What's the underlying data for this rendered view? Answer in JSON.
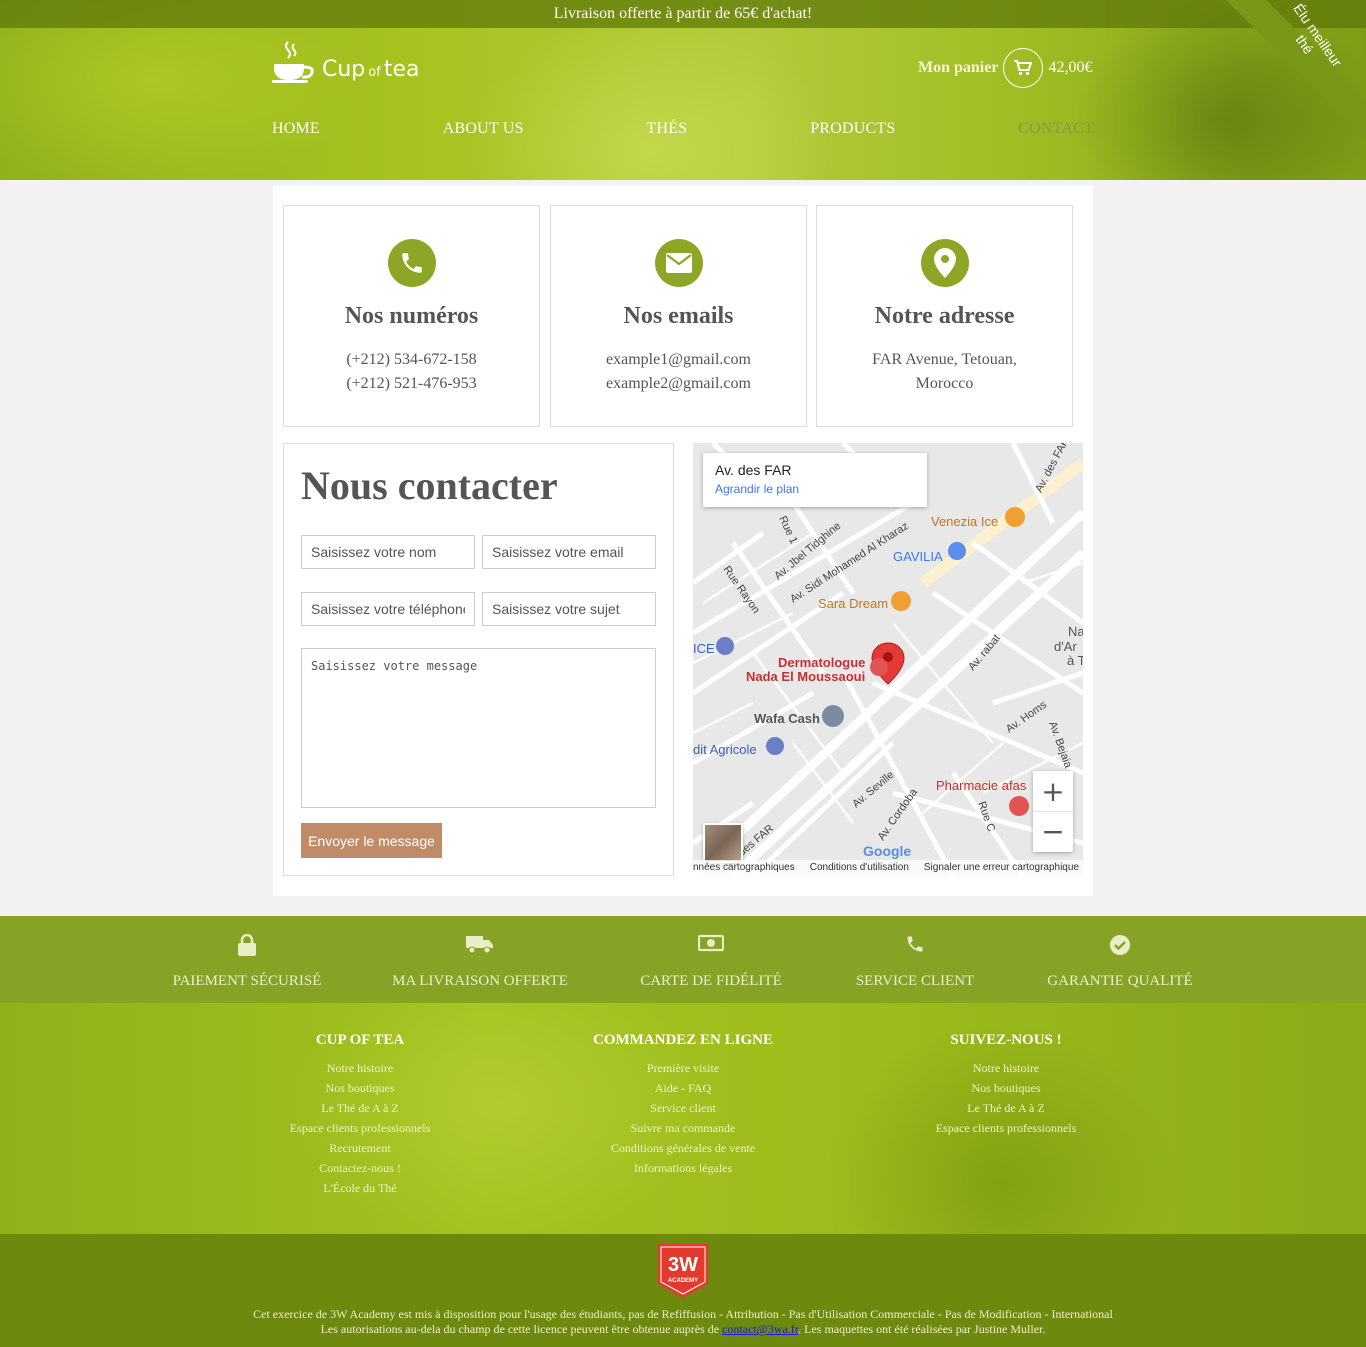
{
  "topbar": {
    "text": "Livraison offerte à partir de 65€ d'achat!"
  },
  "ribbon": {
    "text": "Élu meilleur thé"
  },
  "logo": {
    "word1": "Cup",
    "word2": "of",
    "word3": "tea",
    "icon": "teacup-icon"
  },
  "cart": {
    "label": "Mon panier",
    "amount": "42,00€",
    "icon": "shopping-cart-icon"
  },
  "nav": {
    "items": [
      "HOME",
      "ABOUT US",
      "THÉS",
      "PRODUCTS",
      "CONTACT"
    ],
    "active": "CONTACT"
  },
  "contact_cards": [
    {
      "icon": "phone-icon",
      "title": "Nos numéros",
      "line1": "(+212) 534-672-158",
      "line2": "(+212) 521-476-953"
    },
    {
      "icon": "envelope-icon",
      "title": "Nos emails",
      "line1": "example1@gmail.com",
      "line2": "example2@gmail.com"
    },
    {
      "icon": "map-pin-icon",
      "title": "Notre adresse",
      "line1": "FAR Avenue, Tetouan,",
      "line2": "Morocco"
    }
  ],
  "form": {
    "title": "Nous contacter",
    "name_placeholder": "Saisissez votre nom",
    "email_placeholder": "Saisissez votre email",
    "phone_placeholder": "Saisissez votre téléphone",
    "subject_placeholder": "Saisissez votre sujet",
    "message_placeholder": "Saisissez votre message",
    "submit_label": "Envoyer le message"
  },
  "map": {
    "place_name": "Av. des FAR",
    "enlarge_link": "Agrandir le plan",
    "labels": {
      "venezia": "Venezia Ice",
      "gavilia": "GAVILIA",
      "sara": "Sara Dream",
      "derm1": "Dermatologue",
      "derm2": "Nada El Moussaoui",
      "wafa": "Wafa Cash",
      "credit": "dit Agricole",
      "pharmacie": "Pharmacie afas",
      "ice": "ICE",
      "na1": "Na",
      "na2": "d'Ar",
      "na3": "à T",
      "st_far_top": "Av. des FAR",
      "st_far_bottom": "Av. des FAR",
      "st_jbel": "Av. Jbel Tidghine",
      "st_sidi": "Av. Sidi Mohamed Al Kharaz",
      "st_rayon": "Rue Rayon",
      "st_rue1": "Rue 1",
      "st_rabat": "Av. rabat",
      "st_homs": "Av. Homs",
      "st_bejaia": "Av. Bejaia",
      "st_seville": "Av. Seville",
      "st_cordoba": "Av. Cordoba",
      "st_ruec": "Rue C"
    },
    "google": "Google",
    "footer_data": "nnées cartographiques",
    "footer_terms": "Conditions d'utilisation",
    "footer_report": "Signaler une erreur cartographique",
    "zoom_in": "+",
    "zoom_out": "−"
  },
  "services": [
    {
      "icon": "lock-icon",
      "label": "PAIEMENT SÉCURISÉ"
    },
    {
      "icon": "truck-icon",
      "label": "MA LIVRAISON OFFERTE"
    },
    {
      "icon": "money-bill-icon",
      "label": "CARTE DE FIDÉLITÉ"
    },
    {
      "icon": "phone-icon",
      "label": "SERVICE CLIENT"
    },
    {
      "icon": "check-circle-icon",
      "label": "GARANTIE QUALITÉ"
    }
  ],
  "footer": {
    "columns": [
      {
        "title": "CUP OF TEA",
        "links": [
          "Notre histoire",
          "Nos boutiques",
          "Le Thé de A à Z",
          "Espace clients professionnels",
          "Recrutement",
          "Contactez-nous !",
          "L'École du Thé"
        ]
      },
      {
        "title": "COMMANDEZ EN LIGNE",
        "links": [
          "Première visite",
          "Aide - FAQ",
          "Service client",
          "Suivre ma commande",
          "Conditions générales de vente",
          "Informations légales"
        ]
      },
      {
        "title": "SUIVEZ-NOUS !",
        "links": [
          "Notre histoire",
          "Nos boutiques",
          "Le Thé de A à Z",
          "Espace clients professionnels"
        ]
      }
    ],
    "badge": {
      "top": "3W",
      "bottom": "ACADEMY"
    },
    "legal_line1": "Cet exercice de 3W Academy est mis à disposition pour l'usage des étudiants, pas de Refiffusion - Attribution - Pas d'Utilisation Commerciale - Pas de Modification - International",
    "legal_line2_before": "Les autorisations au-dela du champ de cette licence peuvent être obtenue auprès de",
    "legal_email": "contact@3wa.fr",
    "legal_line2_after": ". Les maquettes ont été réalisées par Justine Muller."
  }
}
